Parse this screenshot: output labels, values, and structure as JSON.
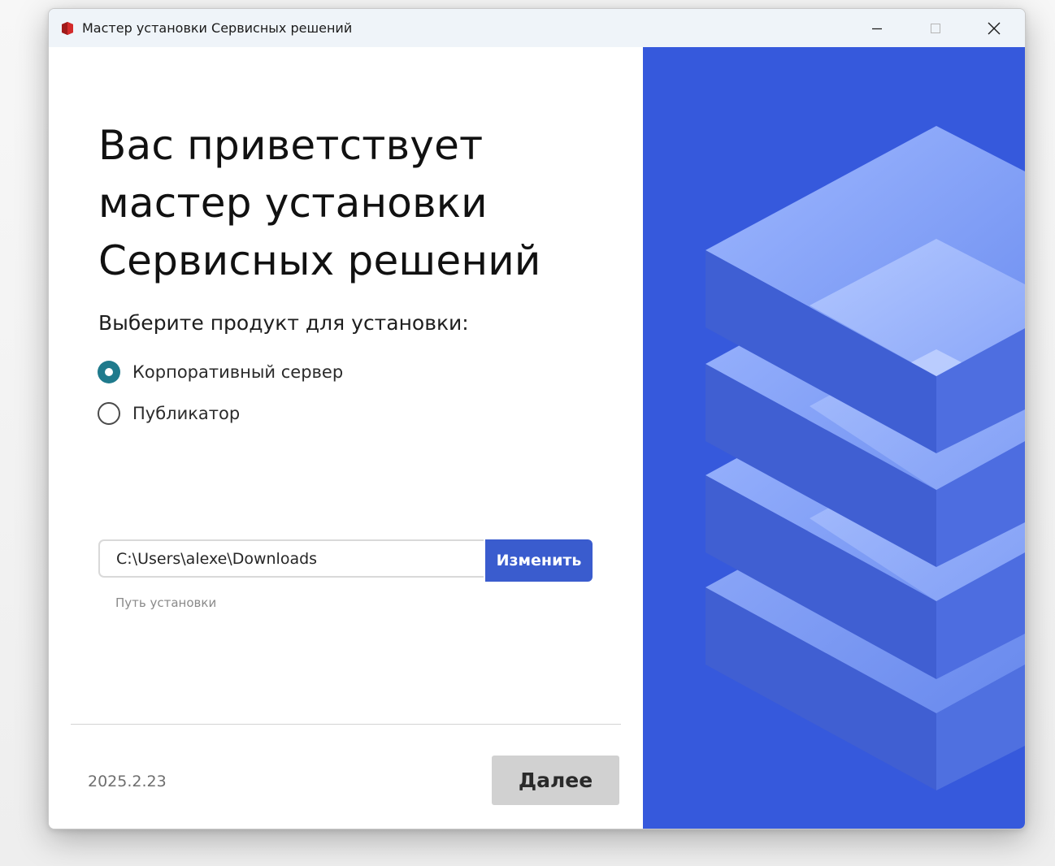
{
  "window": {
    "title": "Мастер установки Сервисных решений",
    "controls": [
      "minimize-icon",
      "maximize-icon",
      "close-icon"
    ]
  },
  "main": {
    "heading_lines": [
      "Вас приветствует",
      "мастер установки",
      "Сервисных решений"
    ],
    "product_prompt": "Выберите продукт для установки:",
    "products": [
      {
        "label": "Корпоративный сервер",
        "selected": true
      },
      {
        "label": "Публикатор",
        "selected": false
      }
    ],
    "install_path": {
      "value": "C:\\Users\\alexe\\Downloads",
      "change_label": "Изменить",
      "caption": "Путь установки"
    }
  },
  "footer": {
    "version": "2025.2.23",
    "next_label": "Далее"
  },
  "colors": {
    "accent": "#3a5cce",
    "side_panel": "#3659dc",
    "radio_selected": "#1f7a8c",
    "next_button": "#d1d1d1"
  },
  "illustration": "stacked-layers-illustration"
}
